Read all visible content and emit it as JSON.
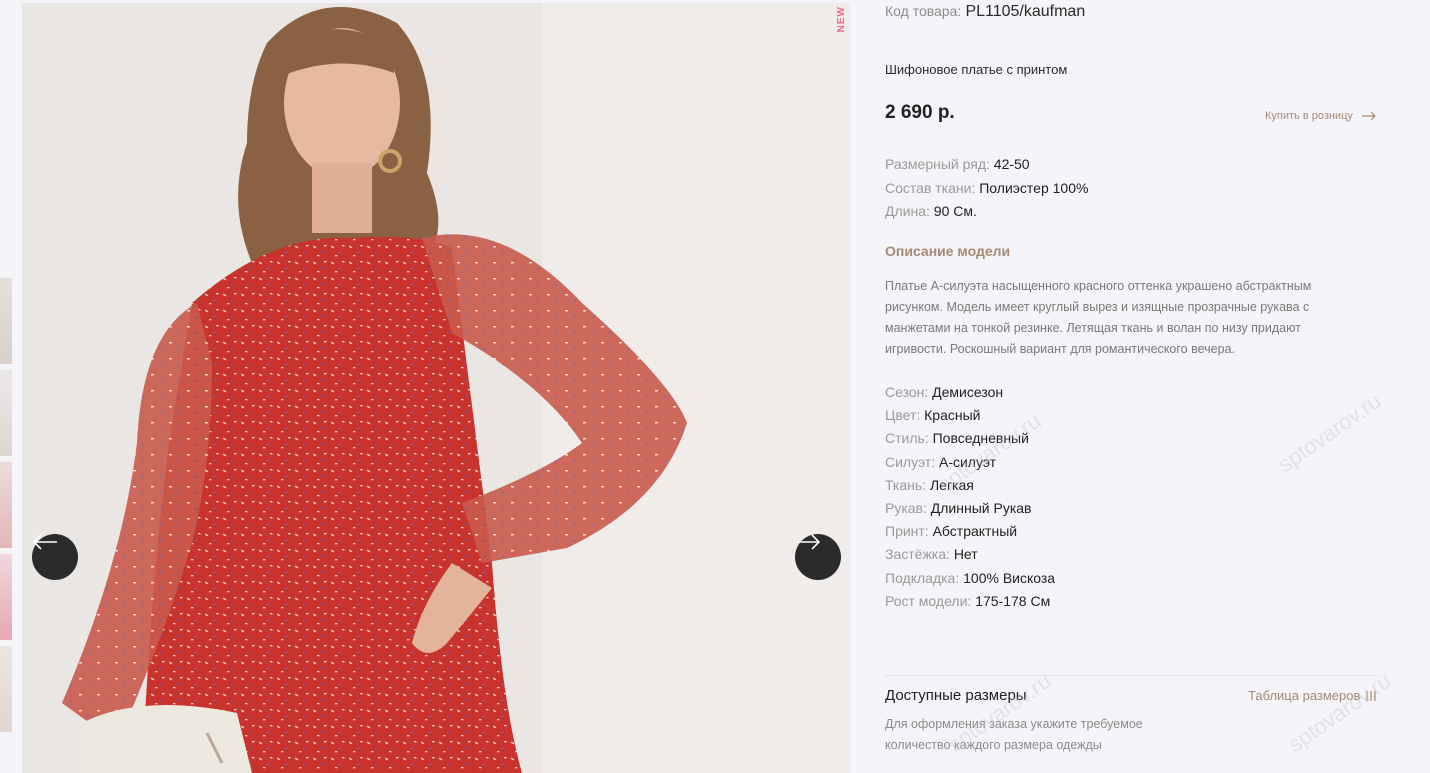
{
  "badge": {
    "new": "NEW"
  },
  "gallery": {
    "prev_icon": "arrow-left-icon",
    "next_icon": "arrow-right-icon"
  },
  "product": {
    "sku_label": "Код товара:",
    "sku_value": "PL1105/kaufman",
    "name": "Шифоновое платье с принтом",
    "price": "2 690 р.",
    "retail_link": "Купить в розницу",
    "specs": [
      {
        "label": "Размерный ряд:",
        "value": "42-50"
      },
      {
        "label": "Состав ткани:",
        "value": "Полиэстер 100%"
      },
      {
        "label": "Длина:",
        "value": "90 См."
      }
    ],
    "description_title": "Описание модели",
    "description": "Платье А-силуэта насыщенного красного оттенка украшено абстрактным рисунком. Модель имеет круглый вырез и изящные прозрачные рукава с манжетами на тонкой резинке. Летящая ткань и волан по низу придают игривости. Роскошный вариант для романтического вечера.",
    "attributes": [
      {
        "label": "Сезон:",
        "value": "Демисезон"
      },
      {
        "label": "Цвет:",
        "value": "Красный"
      },
      {
        "label": "Стиль:",
        "value": "Повседневный"
      },
      {
        "label": "Силуэт:",
        "value": "А-силуэт"
      },
      {
        "label": "Ткань:",
        "value": "Легкая"
      },
      {
        "label": "Рукав:",
        "value": "Длинный Рукав"
      },
      {
        "label": "Принт:",
        "value": "Абстрактный"
      },
      {
        "label": "Застёжка:",
        "value": "Нет"
      },
      {
        "label": "Подкладка:",
        "value": "100% Вискоза"
      },
      {
        "label": "Рост модели:",
        "value": "175-178 См"
      }
    ]
  },
  "sizes": {
    "title": "Доступные размеры",
    "table_link": "Таблица размеров",
    "hint": "Для оформления заказа укажите требуемое количество каждого размера одежды"
  },
  "watermark": "sptovarov.ru",
  "colors": {
    "accent": "#a48a73",
    "badge": "#e86c8f",
    "dress": "#c8332d"
  }
}
